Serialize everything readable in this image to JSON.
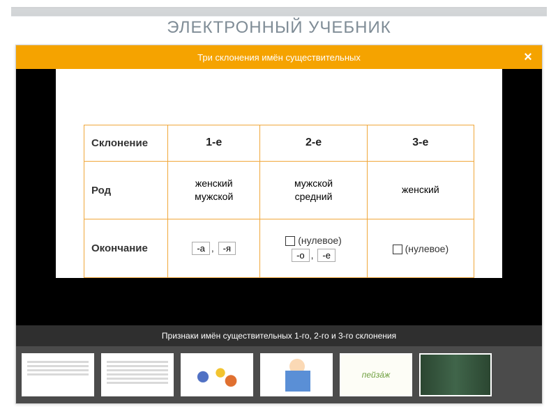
{
  "page_title": "ЭЛЕКТРОННЫЙ УЧЕБНИК",
  "viewer": {
    "header_title": "Три склонения имён существительных",
    "close_label": "×",
    "caption": "Признаки имён существительных 1-го, 2-го и 3-го склонения"
  },
  "table": {
    "row_headers": {
      "declension": "Склонение",
      "gender": "Род",
      "ending": "Окончание"
    },
    "cols": {
      "c1": "1-е",
      "c2": "2-е",
      "c3": "3-е"
    },
    "gender": {
      "c1a": "женский",
      "c1b": "мужской",
      "c2a": "мужской",
      "c2b": "средний",
      "c3": "женский"
    },
    "ending": {
      "c1_a": "-а",
      "c1_sep": ", ",
      "c1_ya": "-я",
      "c2_null": "(нулевое)",
      "c2_o": "-о",
      "c2_sep": ", ",
      "c2_e": "-е",
      "c3_null": "(нулевое)"
    }
  },
  "thumbs": {
    "t5_word": "пейзáж"
  }
}
